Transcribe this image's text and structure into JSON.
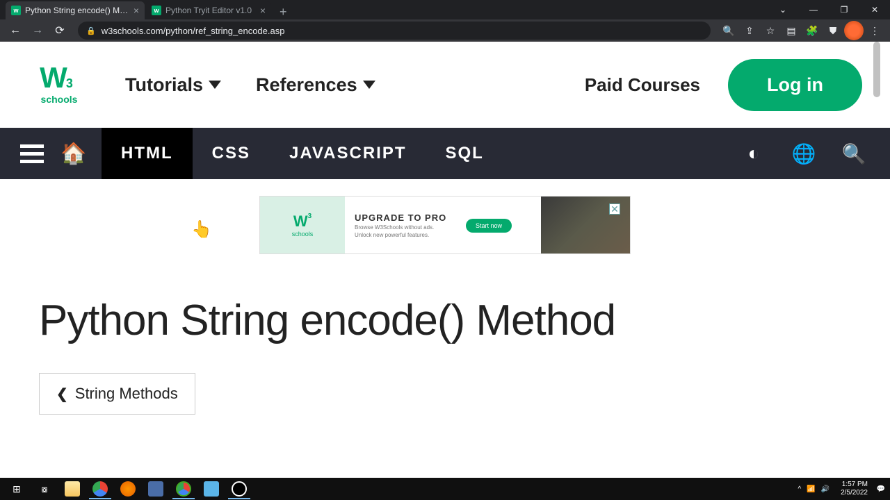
{
  "browser": {
    "tabs": [
      {
        "title": "Python String encode() Method",
        "active": true
      },
      {
        "title": "Python Tryit Editor v1.0",
        "active": false
      }
    ],
    "url": "w3schools.com/python/ref_string_encode.asp"
  },
  "header": {
    "logo_text": "schools",
    "menu": [
      "Tutorials",
      "References"
    ],
    "paid_courses": "Paid Courses",
    "login": "Log in"
  },
  "navbar": {
    "items": [
      "HTML",
      "CSS",
      "JAVASCRIPT",
      "SQL"
    ],
    "active_index": 0
  },
  "ad": {
    "title": "UPGRADE TO PRO",
    "subtitle1": "Browse W3Schools without ads.",
    "subtitle2": "Unlock new powerful features.",
    "cta": "Start now"
  },
  "page": {
    "title": "Python String encode() Method",
    "back_link": "String Methods"
  },
  "taskbar": {
    "time": "1:57 PM",
    "date": "2/5/2022"
  },
  "colors": {
    "brand_green": "#04aa6d",
    "nav_dark": "#282a35"
  }
}
